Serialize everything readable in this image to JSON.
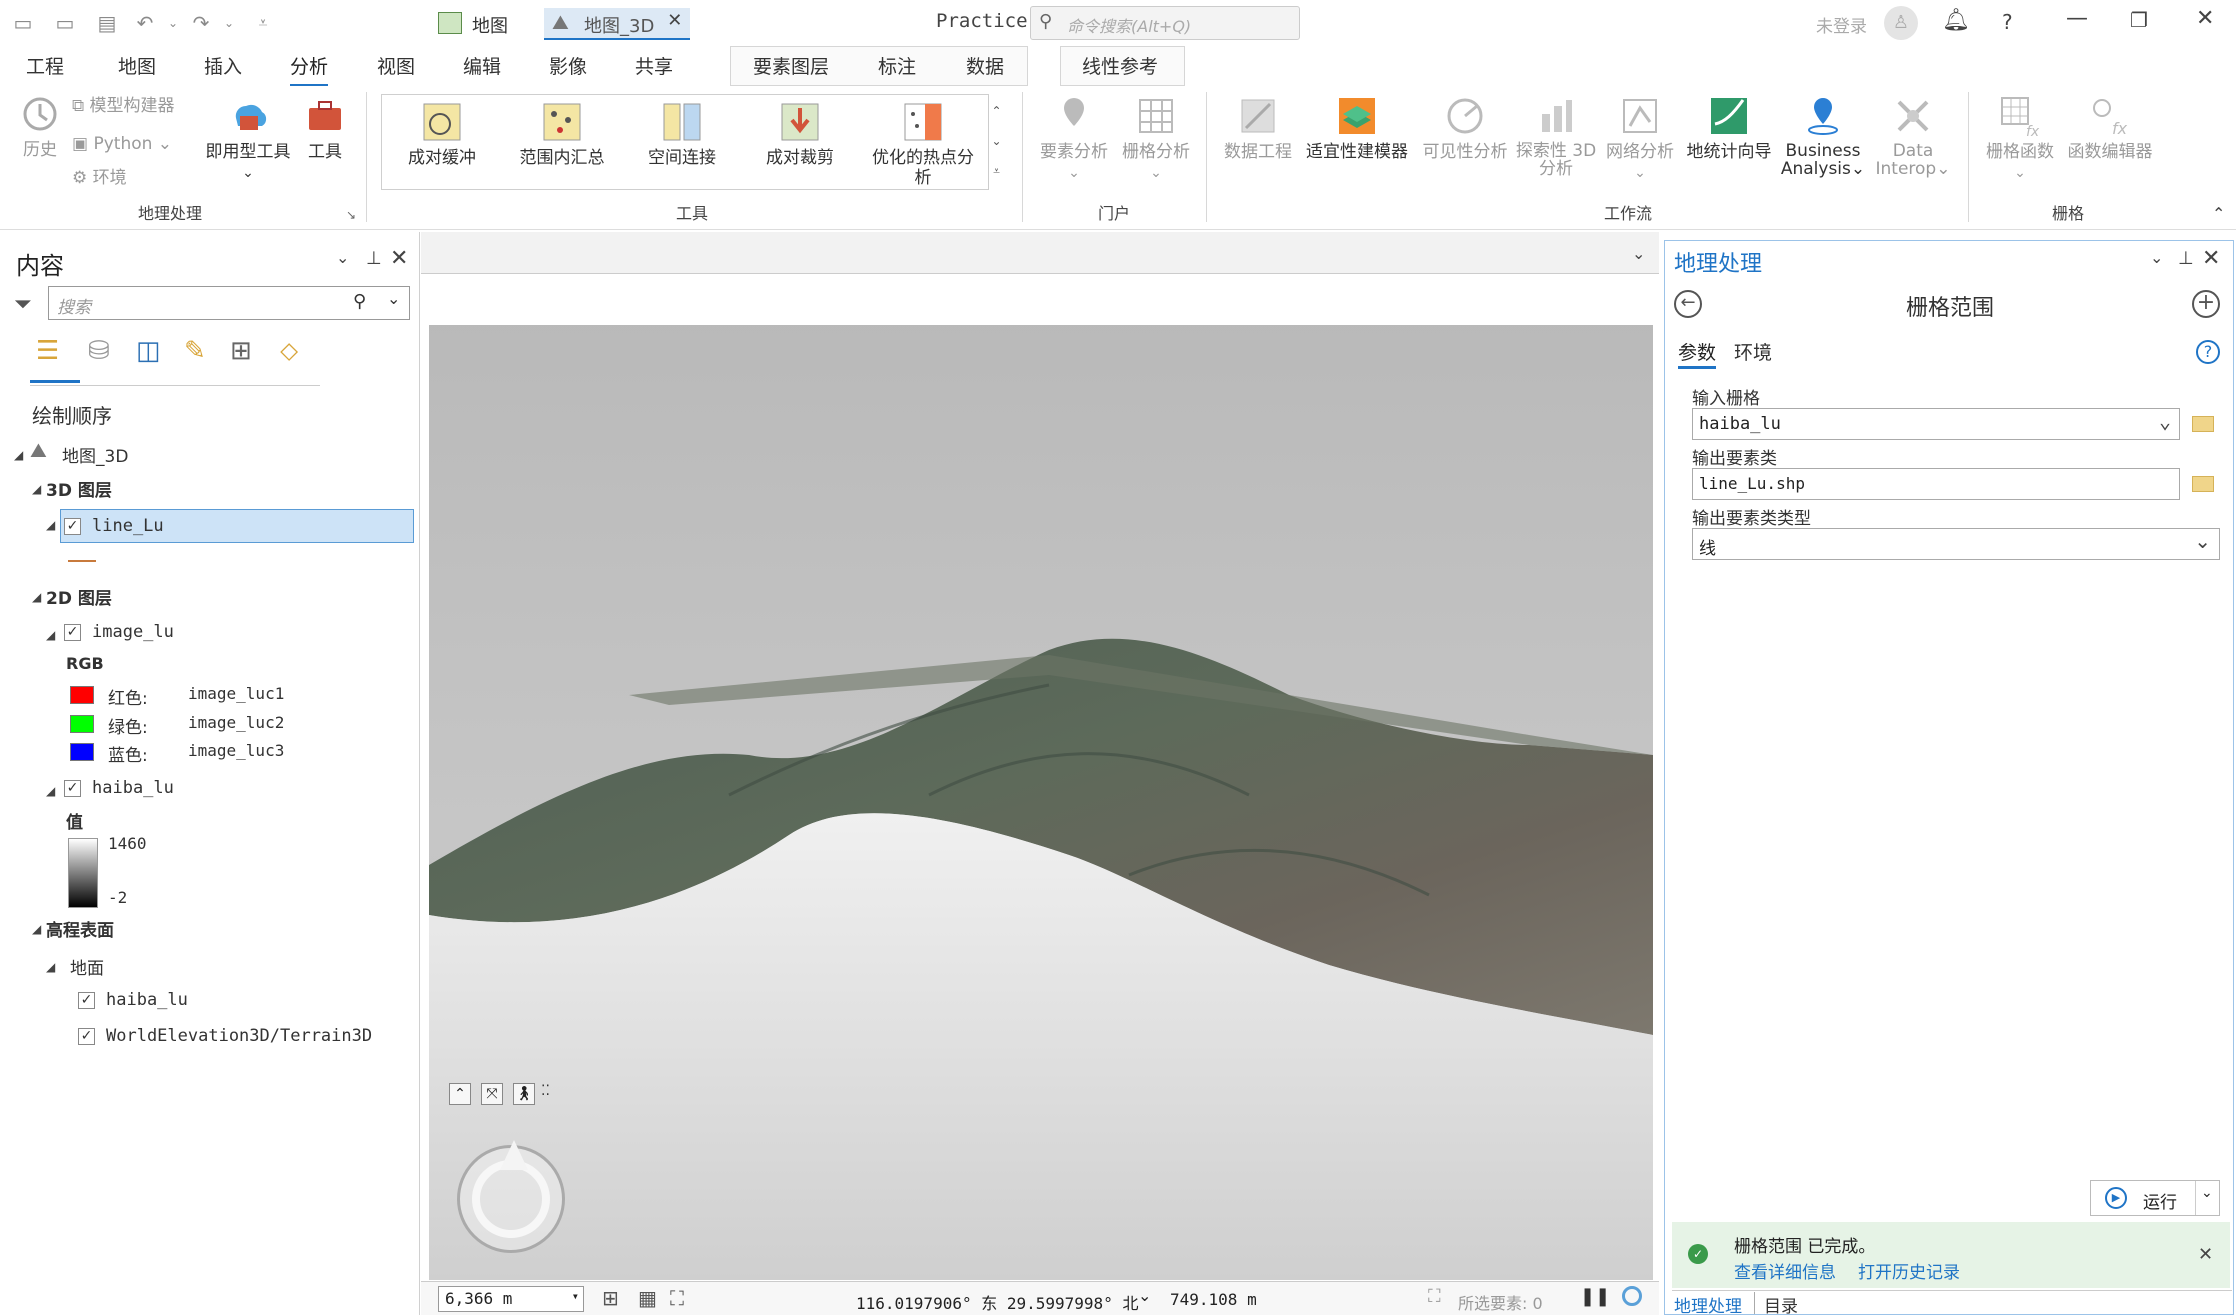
{
  "titlebar": {
    "project": "Practice",
    "search_placeholder": "命令搜索(Alt+Q)",
    "signin": "未登录"
  },
  "menu_tabs": [
    "工程",
    "地图",
    "插入",
    "分析",
    "视图",
    "编辑",
    "影像",
    "共享"
  ],
  "context_tabs": [
    "要素图层",
    "标注",
    "数据"
  ],
  "context_tab2": "线性参考",
  "ribbon": {
    "geo_group": {
      "label": "地理处理",
      "history": "历史",
      "modelbuilder": "模型构建器",
      "python": "Python",
      "env": "环境",
      "ready_tools": "即用型工具",
      "tools": "工具"
    },
    "tools_group": {
      "label": "工具",
      "items": [
        "成对缓冲",
        "范围内汇总",
        "空间连接",
        "成对裁剪",
        "优化的热点分析"
      ]
    },
    "portal_group": {
      "label": "门户",
      "items": [
        "要素分析",
        "栅格分析"
      ]
    },
    "workflow_group": {
      "label": "工作流",
      "items": [
        "数据工程",
        "适宜性建模器",
        "可见性分析",
        "探索性 3D 分析",
        "网络分析",
        "地统计向导",
        "Business Analysis",
        "Data Interop"
      ]
    },
    "raster_group": {
      "label": "栅格",
      "items": [
        "栅格函数",
        "函数编辑器"
      ]
    }
  },
  "contents": {
    "title": "内容",
    "search_placeholder": "搜索",
    "draw_order": "绘制顺序",
    "map": "地图_3D",
    "layers3d": "3D 图层",
    "line_layer": "line_Lu",
    "layers2d": "2D 图层",
    "image_layer": "image_lu",
    "rgb": "RGB",
    "bands": [
      {
        "label": "红色:",
        "value": "image_luc1",
        "color": "#ff0000"
      },
      {
        "label": "绿色:",
        "value": "image_luc2",
        "color": "#00ff00"
      },
      {
        "label": "蓝色:",
        "value": "image_luc3",
        "color": "#0000ff"
      }
    ],
    "dem_layer": "haiba_lu",
    "value_label": "值",
    "max": "1460",
    "min": "-2",
    "elev": "高程表面",
    "ground": "地面",
    "elev_items": [
      "haiba_lu",
      "WorldElevation3D/Terrain3D"
    ]
  },
  "map_tabs": [
    "地图",
    "地图_3D"
  ],
  "status": {
    "scale": "6,366 m",
    "coords": "116.0197906° 东  29.5997998° 北",
    "elevation": "749.108 m",
    "selected": "所选要素: 0"
  },
  "gp": {
    "title": "地理处理",
    "tool": "栅格范围",
    "tab_params": "参数",
    "tab_env": "环境",
    "in_label": "输入栅格",
    "in_value": "haiba_lu",
    "out_label": "输出要素类",
    "out_value": "line_Lu.shp",
    "type_label": "输出要素类类型",
    "type_value": "线",
    "run": "运行",
    "done": "栅格范围 已完成。",
    "details": "查看详细信息",
    "history": "打开历史记录"
  },
  "bottom_tabs": [
    "地理处理",
    "目录"
  ]
}
